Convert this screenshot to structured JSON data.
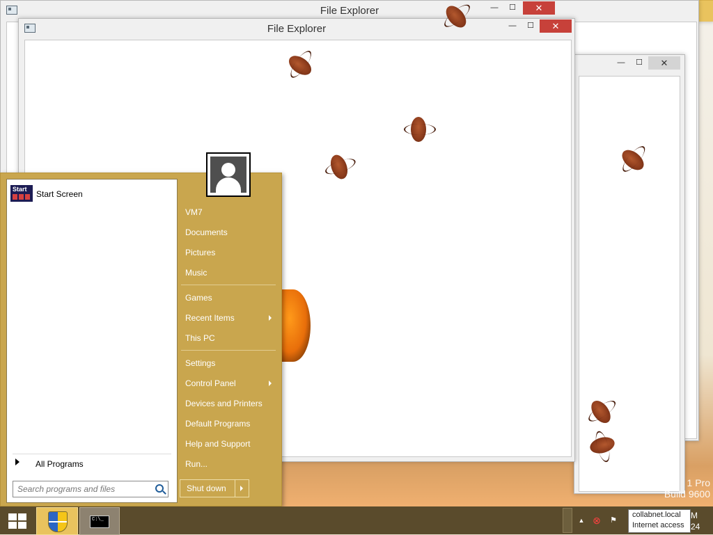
{
  "windows": {
    "back_title": "File Explorer",
    "front_title": "File Explorer",
    "min_glyph": "—",
    "max_glyph": "☐",
    "close_glyph": "✕"
  },
  "desktop": {
    "watermark_line1": "1 Pro",
    "watermark_line2": "Build 9600"
  },
  "start_menu": {
    "pinned": [
      {
        "label": "Start Screen",
        "icon_text": "Start",
        "icon": "start-screen-icon"
      }
    ],
    "all_programs_label": "All Programs",
    "search": {
      "placeholder": "Search programs and files",
      "value": ""
    },
    "user": {
      "icon": "user-avatar-icon"
    },
    "right_items": [
      {
        "label": "VM7"
      },
      {
        "label": "Documents"
      },
      {
        "label": "Pictures"
      },
      {
        "label": "Music"
      },
      {
        "label": "Games"
      },
      {
        "label": "Recent Items",
        "submenu": true
      },
      {
        "label": "This PC"
      },
      {
        "label": "Settings"
      },
      {
        "label": "Control Panel",
        "submenu": true
      },
      {
        "label": "Devices and Printers"
      },
      {
        "label": "Default Programs"
      },
      {
        "label": "Help and Support"
      },
      {
        "label": "Run..."
      }
    ],
    "shutdown_label": "Shut down"
  },
  "taskbar": {
    "cmd_icon_text": "C:\\_",
    "tray_up_glyph": "▲",
    "tray_network_glyph": "⊗",
    "tray_flag_glyph": "⚑",
    "tooltip_line1": "collabnet.local",
    "tooltip_line2": "Internet access",
    "clock_time": "M",
    "clock_date": "24"
  },
  "colors": {
    "accent": "#c9a64e",
    "taskbar": "#5a4b2c",
    "close_red": "#c7413a"
  }
}
